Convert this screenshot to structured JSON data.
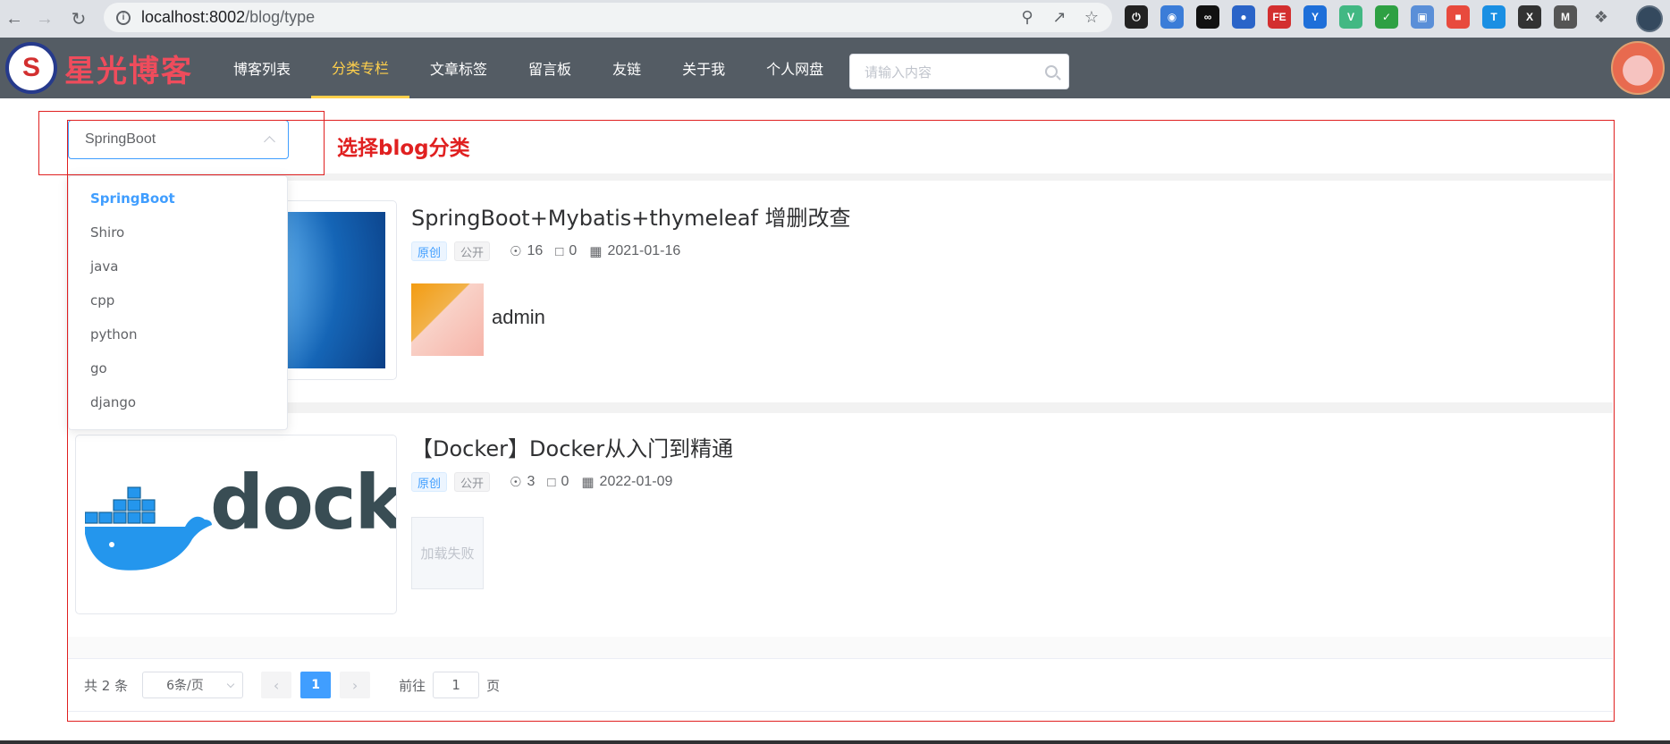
{
  "browser": {
    "url_host": "localhost:8002",
    "url_path": "/blog/type"
  },
  "header": {
    "logo_text": "星光博客",
    "menu": [
      {
        "label": "博客列表"
      },
      {
        "label": "分类专栏",
        "active": true
      },
      {
        "label": "文章标签"
      },
      {
        "label": "留言板"
      },
      {
        "label": "友链"
      },
      {
        "label": "关于我"
      },
      {
        "label": "个人网盘"
      }
    ],
    "search_placeholder": "请输入内容"
  },
  "category_select": {
    "value": "SpringBoot",
    "options": [
      "SpringBoot",
      "Shiro",
      "java",
      "cpp",
      "python",
      "go",
      "django"
    ]
  },
  "annotation": "选择blog分类",
  "posts": [
    {
      "title": "SpringBoot+Mybatis+thymeleaf 增删改查",
      "tag_original": "原创",
      "tag_public": "公开",
      "views": "16",
      "comments": "0",
      "date": "2021-01-16",
      "author": "admin"
    },
    {
      "title": "【Docker】Docker从入门到精通",
      "tag_original": "原创",
      "tag_public": "公开",
      "views": "3",
      "comments": "0",
      "date": "2022-01-09",
      "cover_text": "docke",
      "avatar_fail_text": "加载失败"
    }
  ],
  "pagination": {
    "total": "共 2 条",
    "page_size": "6条/页",
    "current": "1",
    "goto_prefix": "前往",
    "goto_value": "1",
    "goto_suffix": "页"
  },
  "colors": {
    "accent": "#409eff",
    "header_bg": "#545c64",
    "menu_active": "#ffd04b",
    "annotation": "#e02020"
  }
}
